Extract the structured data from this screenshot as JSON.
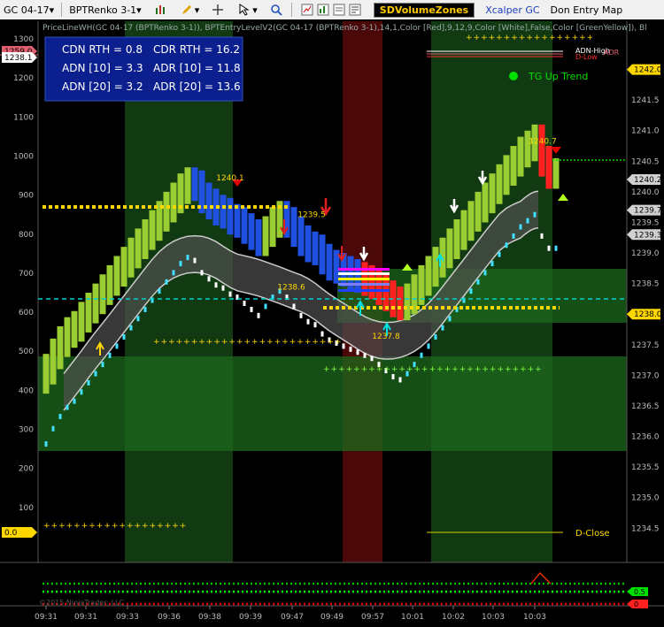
{
  "toolbar": {
    "instrument": "GC 04-17",
    "bartype": "BPTRenko 3-1",
    "sdvolume": "SDVolumeZones",
    "xcalper": "Xcalper GC",
    "don": "Don Entry Map"
  },
  "indicator_line": "PriceLineWH(GC 04-17 (BPTRenko 3-1)), BPTEntryLevelV2(GC 04-17 (BPTRenko 3-1),14,1,Color [Red],9,12,9,Color [White],False,Color [GreenYellow]), Bl",
  "stats": {
    "cdn": "CDN RTH = 0.8",
    "cdr": "CDR RTH = 16.2",
    "adn10": "ADN [10] = 3.3",
    "adr10": "ADR [10] = 11.8",
    "adn20": "ADN [20] = 3.2",
    "adr20": "ADR [20] = 13.6"
  },
  "trend_label": "TG Up Trend",
  "dclose_label": "D-Close",
  "watermark": "©2015 NinjaTrader, LLC",
  "colors": {
    "bull_bar": "#9acd32",
    "bear_bar": "#2060ff",
    "trend_dot": "#00e000",
    "band_fill": "#505050",
    "zone_green": "#1a5a1a",
    "zone_red": "#5a0a0a",
    "level_yellow": "#ffd700",
    "level_cyan": "#00d0d0"
  },
  "chart_data": {
    "type": "candlestick",
    "left_axis": {
      "ticks": [
        "1300",
        "1200",
        "1100",
        "1000",
        "900",
        "800",
        "700",
        "600",
        "500",
        "400",
        "300",
        "200",
        "100"
      ],
      "ylim": [
        0,
        1300
      ]
    },
    "right_axis": {
      "ticks": [
        "1242.0",
        "1241.5",
        "1241.0",
        "1240.5",
        "1240.0",
        "1239.5",
        "1239.0",
        "1238.5",
        "1238.0",
        "1237.5",
        "1237.0",
        "1236.5",
        "1236.0",
        "1235.5",
        "1235.0",
        "1234.5"
      ],
      "ylim": [
        1234.2,
        1242.5
      ]
    },
    "x_ticks": [
      "09:31",
      "09:31",
      "09:33",
      "09:36",
      "09:38",
      "09:39",
      "09:47",
      "09:49",
      "09:57",
      "10:01",
      "10:02",
      "10:03",
      "10:03"
    ],
    "price_flags": [
      {
        "label": "1242.0",
        "value": 1242.0,
        "color": "#ffd700"
      },
      {
        "label": "1240.2",
        "value": 1240.2,
        "color": "#d0d0d0"
      },
      {
        "label": "1239.7",
        "value": 1239.7,
        "color": "#d0d0d0"
      },
      {
        "label": "1239.3",
        "value": 1239.3,
        "color": "#d0d0d0"
      },
      {
        "label": "1238.0",
        "value": 1238.0,
        "color": "#ffd700"
      }
    ],
    "left_flags": [
      {
        "label": "1259.0",
        "value": 1259.0,
        "color": "#e06070"
      },
      {
        "label": "1238.1",
        "value": 1238.1,
        "color": "#ffffff"
      },
      {
        "label": "0.0",
        "value": 0,
        "color": "#ffd700"
      }
    ],
    "annotations": [
      {
        "text": "1240.1",
        "price": 1240.1
      },
      {
        "text": "1239.5",
        "price": 1239.5
      },
      {
        "text": "1238.6",
        "price": 1238.6
      },
      {
        "text": "1237.8",
        "price": 1237.8
      },
      {
        "text": "1240.7",
        "price": 1240.7
      }
    ],
    "legend_tags": [
      "ADN-High",
      "ADR",
      "D-Low"
    ],
    "subpanel_flags": [
      "0.5",
      "0"
    ],
    "bars": [
      1236.9,
      1237.15,
      1237.35,
      1237.5,
      1237.6,
      1237.75,
      1237.9,
      1238.05,
      1238.2,
      1238.35,
      1238.5,
      1238.65,
      1238.8,
      1238.95,
      1239.1,
      1239.25,
      1239.4,
      1239.55,
      1239.7,
      1239.85,
      1239.95,
      1239.9,
      1239.7,
      1239.6,
      1239.5,
      1239.45,
      1239.35,
      1239.3,
      1239.2,
      1239.1,
      1239.0,
      1239.15,
      1239.3,
      1239.4,
      1239.3,
      1239.15,
      1239.0,
      1238.9,
      1238.85,
      1238.7,
      1238.6,
      1238.55,
      1238.5,
      1238.45,
      1238.4,
      1238.35,
      1238.3,
      1238.2,
      1238.1,
      1238.0,
      1237.95,
      1238.05,
      1238.2,
      1238.35,
      1238.5,
      1238.65,
      1238.8,
      1238.95,
      1239.1,
      1239.25,
      1239.4,
      1239.55,
      1239.7,
      1239.85,
      1240.0,
      1240.15,
      1240.3,
      1240.45,
      1240.55,
      1240.65,
      1240.3,
      1240.1,
      1240.1
    ]
  }
}
